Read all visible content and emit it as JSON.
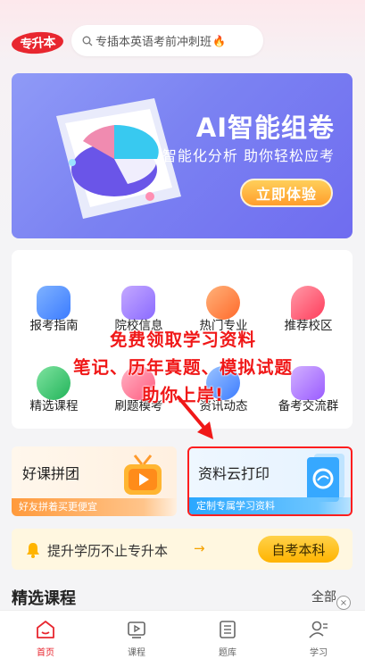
{
  "header": {
    "logo_text": "专升本",
    "search_placeholder": "专插本英语考前冲刺班",
    "search_icon": "search-icon",
    "fire_icon": "fire-icon"
  },
  "banner": {
    "title": "AI智能组卷",
    "subtitle": "智能化分析 助你轻松应考",
    "cta": "立即体验",
    "art_text": "AI"
  },
  "grid": {
    "items": [
      {
        "label": "报考指南",
        "icon": "guide-icon",
        "color": "#4c8dff"
      },
      {
        "label": "院校信息",
        "icon": "school-icon",
        "color": "#9a7bff"
      },
      {
        "label": "热门专业",
        "icon": "major-icon",
        "color": "#ff8a3d"
      },
      {
        "label": "推荐校区",
        "icon": "location-icon",
        "color": "#ff5a6e"
      },
      {
        "label": "精选课程",
        "icon": "play-icon",
        "color": "#37c76a"
      },
      {
        "label": "刷题模考",
        "icon": "exam-icon",
        "color": "#ff6b8a"
      },
      {
        "label": "资讯动态",
        "icon": "news-icon",
        "color": "#4c8dff"
      },
      {
        "label": "备考交流群",
        "icon": "chat-icon",
        "color": "#a070ff"
      }
    ]
  },
  "promo": {
    "line1": "免费领取学习资料",
    "line2": "笔记、历年真题、模拟试题",
    "line3": "助你上岸!"
  },
  "cards": {
    "left": {
      "title": "好课拼团",
      "strip": "好友拼着买更便宜"
    },
    "right": {
      "title": "资料云打印",
      "strip": "定制专属学习资料"
    }
  },
  "notice": {
    "text": "提升学历不止专升本",
    "arrow": "→",
    "button": "自考本科"
  },
  "section": {
    "title": "精选课程",
    "all": "全部",
    "close": "×"
  },
  "tabbar": {
    "tabs": [
      {
        "label": "首页",
        "icon": "home-icon",
        "active": true
      },
      {
        "label": "课程",
        "icon": "video-icon",
        "active": false
      },
      {
        "label": "题库",
        "icon": "list-icon",
        "active": false
      },
      {
        "label": "学习",
        "icon": "user-icon",
        "active": false
      }
    ]
  },
  "colors": {
    "brand_red": "#e8262f",
    "banner_purple": "#7b82f2",
    "cta_orange": "#ff9e2c",
    "notice_yellow": "#ffb400"
  }
}
